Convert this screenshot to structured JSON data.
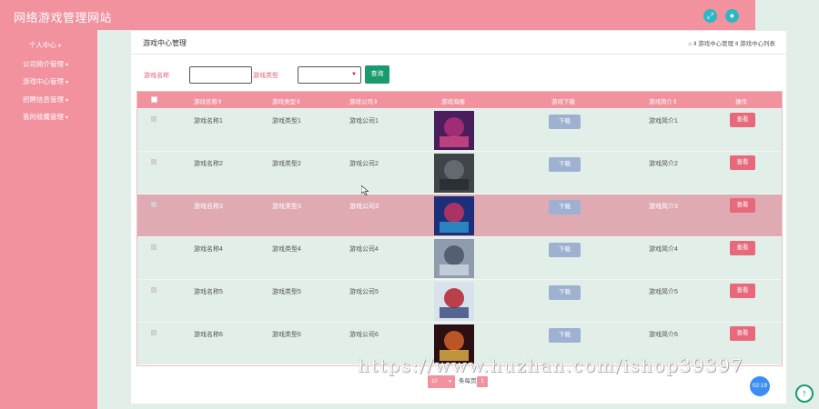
{
  "site_title": "网络游戏管理网站",
  "icons": {
    "fullscreen": "fullscreen-icon",
    "user": "user-icon",
    "home": "home-icon",
    "to_top": "arrow-up-icon"
  },
  "sidebar": {
    "items": [
      {
        "label": "个人中心"
      },
      {
        "label": "公司简介管理"
      },
      {
        "label": "游戏中心管理"
      },
      {
        "label": "招聘信息管理"
      },
      {
        "label": "我的收藏管理"
      }
    ]
  },
  "panel": {
    "title": "游戏中心管理",
    "breadcrumb": "Ⅱ 游戏中心管理 Ⅱ 游戏中心列表"
  },
  "search": {
    "name_label": "游戏名称",
    "name_value": "",
    "type_label": "游戏类型",
    "type_value": "",
    "button": "查询"
  },
  "table": {
    "headers": [
      "游戏名称⇕",
      "游戏类型⇕",
      "游戏公司⇕",
      "游戏海报",
      "游戏下载",
      "游戏简介⇕",
      "操作"
    ],
    "download_label": "下载",
    "view_label": "查看",
    "highlight_row": 3,
    "rows": [
      {
        "name": "游戏名称1",
        "type": "游戏类型1",
        "company": "游戏公司1",
        "intro": "游戏简介1"
      },
      {
        "name": "游戏名称2",
        "type": "游戏类型2",
        "company": "游戏公司2",
        "intro": "游戏简介2"
      },
      {
        "name": "游戏名称3",
        "type": "游戏类型3",
        "company": "游戏公司3",
        "intro": "游戏简介3"
      },
      {
        "name": "游戏名称4",
        "type": "游戏类型4",
        "company": "游戏公司4",
        "intro": "游戏简介4"
      },
      {
        "name": "游戏名称5",
        "type": "游戏类型5",
        "company": "游戏公司5",
        "intro": "游戏简介5"
      },
      {
        "name": "游戏名称6",
        "type": "游戏类型6",
        "company": "游戏公司6",
        "intro": "游戏简介6"
      }
    ]
  },
  "pagination": {
    "page_size": "10",
    "per_page_label": "条每页",
    "current_page": "1"
  },
  "watermark": "https://www.huzhan.com/ishop39397",
  "clock": "02:19",
  "colors": {
    "brand_pink": "#f2929f",
    "page_bg": "#e2efe9",
    "search_green": "#1a9b6e",
    "download_blue": "#9fb1d1",
    "view_red": "#e8697b"
  }
}
